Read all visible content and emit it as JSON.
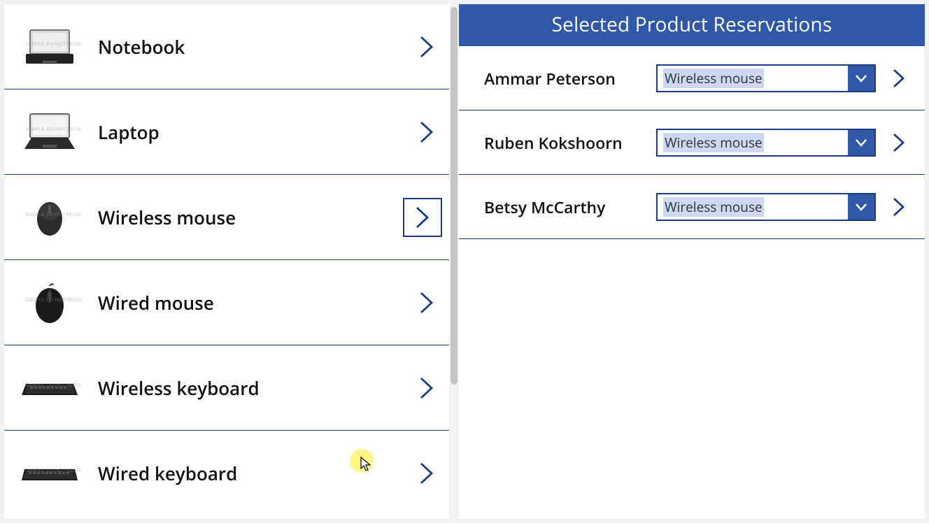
{
  "colors": {
    "accent": "#2f58a9",
    "line": "#1b3b87"
  },
  "products": [
    {
      "id": "notebook",
      "label": "Notebook",
      "icon": "laptop-open",
      "selected": false
    },
    {
      "id": "laptop",
      "label": "Laptop",
      "icon": "laptop-closed",
      "selected": false
    },
    {
      "id": "wireless-mouse",
      "label": "Wireless mouse",
      "icon": "mouse-small",
      "selected": true
    },
    {
      "id": "wired-mouse",
      "label": "Wired mouse",
      "icon": "mouse-wired",
      "selected": false
    },
    {
      "id": "wireless-keyboard",
      "label": "Wireless keyboard",
      "icon": "keyboard",
      "selected": false
    },
    {
      "id": "wired-keyboard",
      "label": "Wired keyboard",
      "icon": "keyboard",
      "selected": false
    }
  ],
  "reservations_header": "Selected Product Reservations",
  "reservations": [
    {
      "name": "Ammar Peterson",
      "product": "Wireless mouse"
    },
    {
      "name": "Ruben Kokshoorn",
      "product": "Wireless mouse"
    },
    {
      "name": "Betsy McCarthy",
      "product": "Wireless mouse"
    }
  ],
  "watermark": "SAMPLE.\nDO NOT REUSE."
}
